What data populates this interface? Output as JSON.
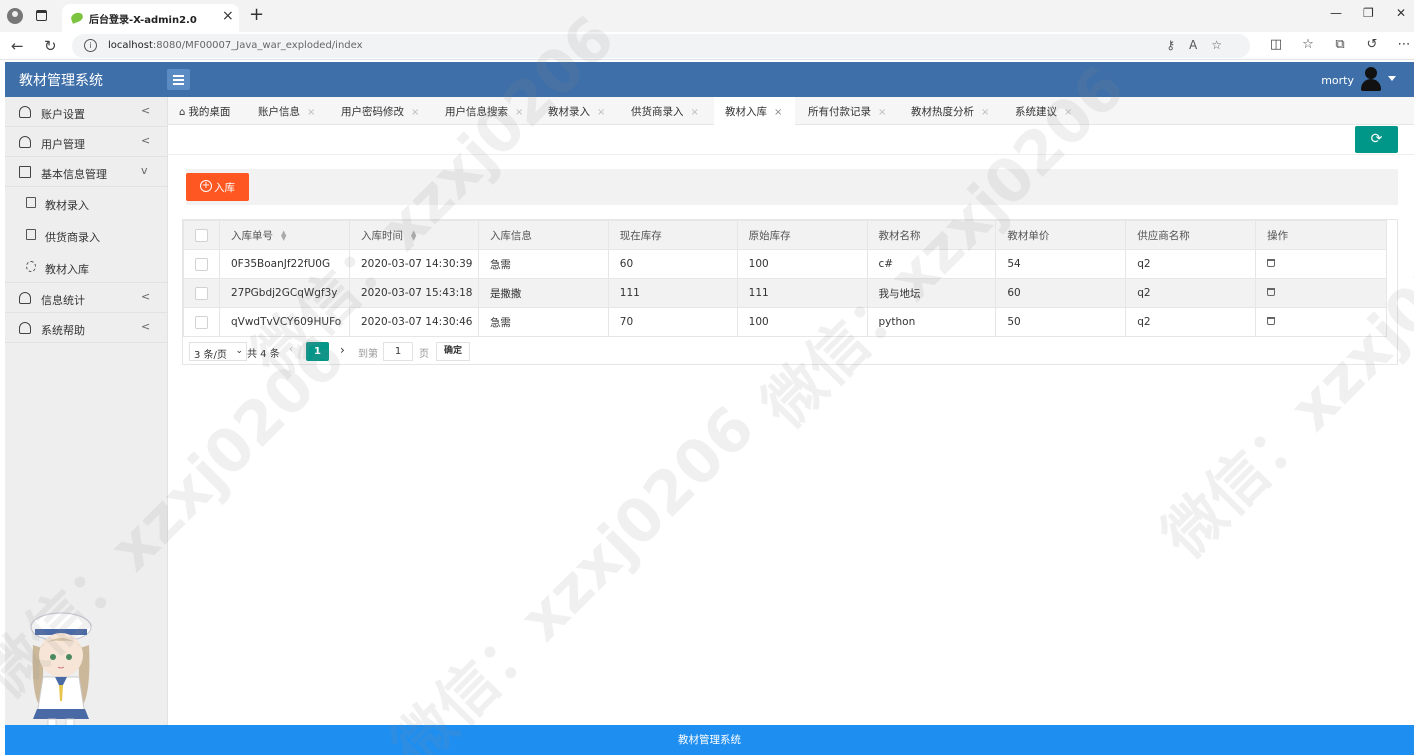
{
  "browser": {
    "tab_title": "后台登录-X-admin2.0",
    "url_host": "localhost",
    "url_rest": ":8080/MF00007_Java_war_exploded/index"
  },
  "app": {
    "title": "教材管理系统",
    "user": "morty",
    "footer": "教材管理系统"
  },
  "sidebar": {
    "items": [
      {
        "label": "账户设置",
        "icon": "user-icon",
        "arrow": "<"
      },
      {
        "label": "用户管理",
        "icon": "user-icon",
        "arrow": "<"
      },
      {
        "label": "基本信息管理",
        "icon": "box-icon",
        "arrow": "v"
      },
      {
        "label": "信息统计",
        "icon": "user-icon",
        "arrow": "<"
      },
      {
        "label": "系统帮助",
        "icon": "user-icon",
        "arrow": "<"
      }
    ],
    "subitems": [
      {
        "label": "教材录入",
        "icon": "document-icon"
      },
      {
        "label": "供货商录入",
        "icon": "document-icon"
      },
      {
        "label": "教材入库",
        "icon": "gear-icon"
      }
    ]
  },
  "tabs": [
    {
      "label": "我的桌面"
    },
    {
      "label": "账户信息"
    },
    {
      "label": "用户密码修改"
    },
    {
      "label": "用户信息搜索"
    },
    {
      "label": "教材录入"
    },
    {
      "label": "供货商录入"
    },
    {
      "label": "教材入库",
      "active": true
    },
    {
      "label": "所有付款记录"
    },
    {
      "label": "教材热度分析"
    },
    {
      "label": "系统建议"
    }
  ],
  "toolbar": {
    "add_label": "入库"
  },
  "table": {
    "columns": [
      "入库单号",
      "入库时间",
      "入库信息",
      "现在库存",
      "原始库存",
      "教材名称",
      "教材单价",
      "供应商名称",
      "操作"
    ],
    "rows": [
      [
        "0F35BoanJf22fU0G",
        "2020-03-07 14:30:39",
        "急需",
        "60",
        "100",
        "c#",
        "54",
        "q2"
      ],
      [
        "27PGbdj2GCqWgf3y",
        "2020-03-07 15:43:18",
        "是撒撒",
        "111",
        "111",
        "我与地坛",
        "60",
        "q2"
      ],
      [
        "qVwdTvVCY609HUFo",
        "2020-03-07 14:30:46",
        "急需",
        "70",
        "100",
        "python",
        "50",
        "q2"
      ]
    ]
  },
  "pager": {
    "per_page": "3 条/页",
    "total": "共 4 条",
    "current": "1",
    "goto_label": "到第",
    "goto_value": "1",
    "page_label": "页",
    "ok": "确定"
  },
  "watermark": "微信：xzxj0206"
}
